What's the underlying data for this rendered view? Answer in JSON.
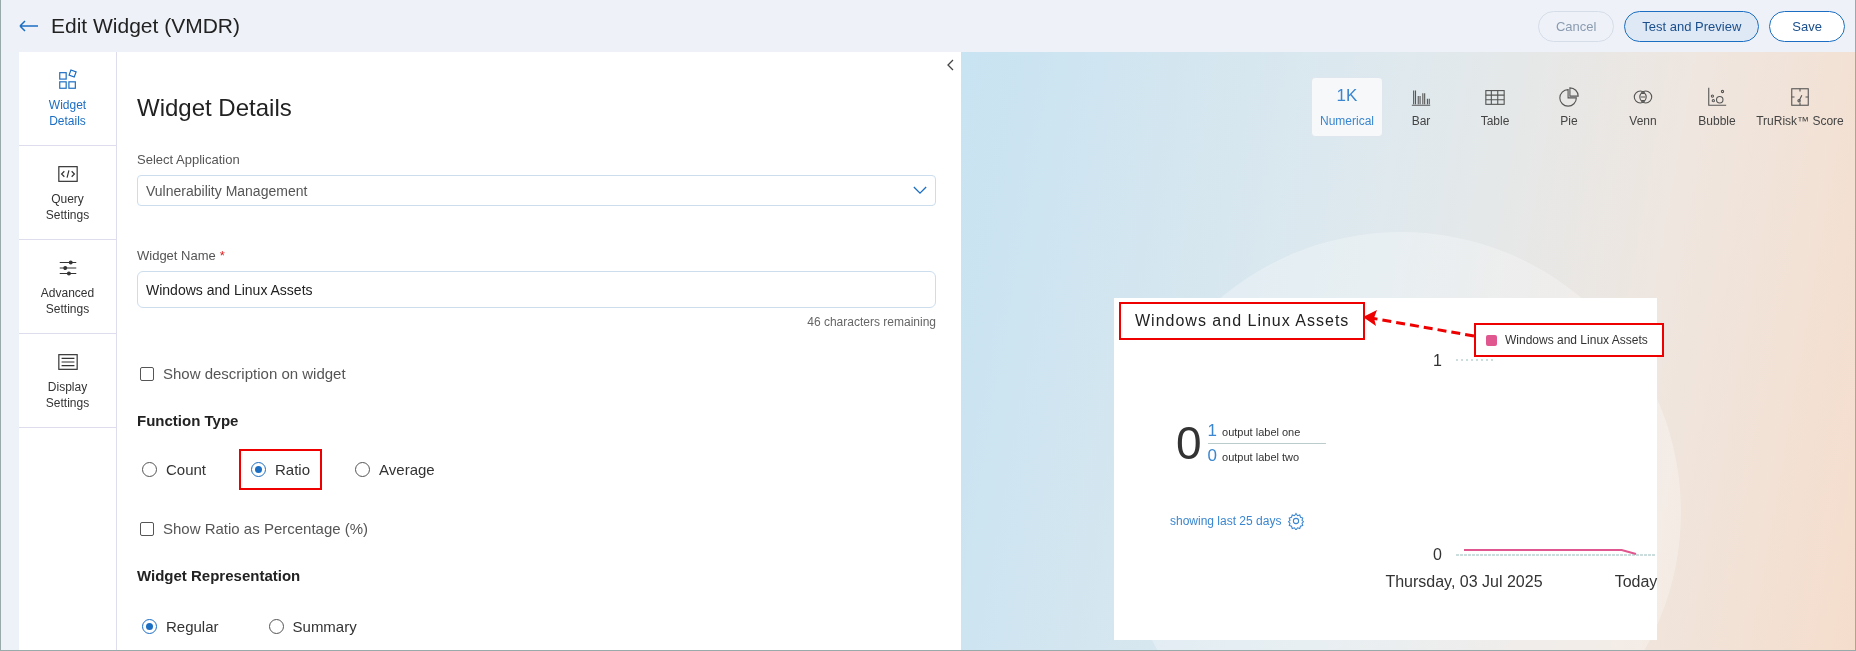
{
  "header": {
    "title": "Edit Widget (VMDR)",
    "buttons": [
      {
        "label": "Cancel",
        "kind": "secondary",
        "disabled": true
      },
      {
        "label": "Test and Preview",
        "kind": "secondary",
        "disabled": false
      },
      {
        "label": "Save",
        "kind": "primary",
        "disabled": false
      }
    ]
  },
  "sidebar": {
    "items": [
      {
        "label": "Widget Details",
        "kind": "details",
        "selected": true
      },
      {
        "label": "Query Settings",
        "kind": "query",
        "selected": false
      },
      {
        "label": "Advanced Settings",
        "kind": "advanced",
        "selected": false
      },
      {
        "label": "Display Settings",
        "kind": "display",
        "selected": false
      }
    ]
  },
  "form": {
    "heading": "Widget Details",
    "application": {
      "label": "Select Application",
      "value": "Vulnerability Management"
    },
    "widget_name": {
      "label": "Widget Name",
      "required_mark": "*",
      "value": "Windows and Linux Assets",
      "hint": "46 characters remaining"
    },
    "show_description": {
      "label": "Show description on widget",
      "checked": false
    },
    "function_type": {
      "label": "Function Type",
      "options": [
        {
          "label": "Count",
          "selected": false,
          "highlighted": false
        },
        {
          "label": "Ratio",
          "selected": true,
          "highlighted": true
        },
        {
          "label": "Average",
          "selected": false,
          "highlighted": false
        }
      ]
    },
    "show_ratio_percentage": {
      "label": "Show Ratio as Percentage (%)",
      "checked": false
    },
    "representation": {
      "label": "Widget Representation",
      "options": [
        {
          "label": "Regular",
          "selected": true
        },
        {
          "label": "Summary",
          "selected": false
        }
      ]
    }
  },
  "chart_types": [
    {
      "kind": "numerical",
      "glyph": "1K",
      "label": "Numerical",
      "selected": true
    },
    {
      "kind": "bar",
      "label": "Bar",
      "selected": false
    },
    {
      "kind": "table",
      "label": "Table",
      "selected": false
    },
    {
      "kind": "pie",
      "label": "Pie",
      "selected": false
    },
    {
      "kind": "venn",
      "label": "Venn",
      "selected": false
    },
    {
      "kind": "bubble",
      "label": "Bubble",
      "selected": false
    },
    {
      "kind": "score",
      "label": "TruRisk™ Score",
      "selected": false
    }
  ],
  "widget_card": {
    "title": "Windows and Linux Assets",
    "title_highlighted": true,
    "legend_highlighted": true,
    "arrow": true,
    "value": "0",
    "outputs": [
      {
        "value": "1",
        "label": "output label one"
      },
      {
        "value": "0",
        "label": "output label two"
      }
    ],
    "footer_link": "showing last 25 days",
    "chart_data": {
      "type": "line",
      "categories": [
        "Thursday, 03 Jul 2025",
        null,
        null,
        null,
        null,
        null,
        null,
        null,
        null,
        null,
        null,
        null,
        "Today"
      ],
      "ylim": [
        0,
        1
      ],
      "yticks": [
        0,
        1
      ],
      "series": [
        {
          "name": "Windows and Linux Assets",
          "color": "#e0568f",
          "values": [
            0.02,
            0.02,
            0.02,
            0.02,
            0.02,
            0.02,
            0.02,
            0.02,
            0.02,
            0.02,
            0.02,
            0.02,
            0
          ]
        }
      ]
    }
  }
}
